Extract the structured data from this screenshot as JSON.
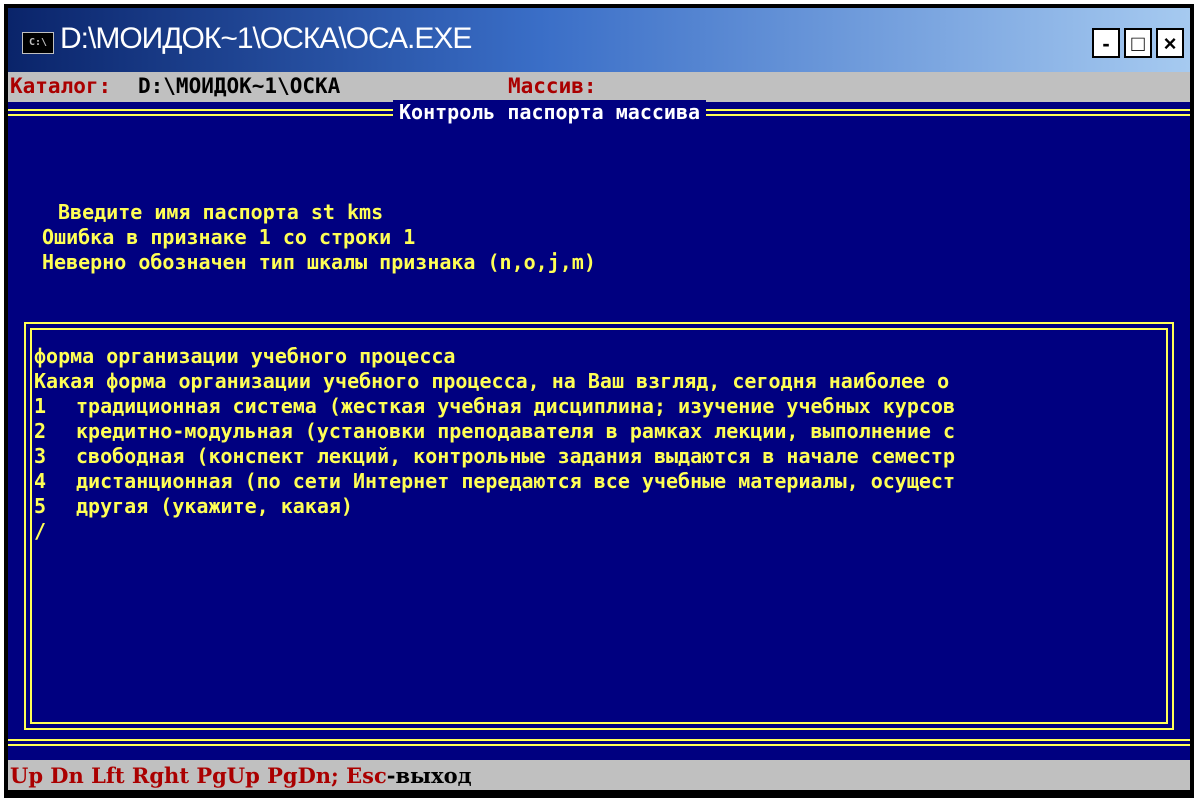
{
  "window": {
    "title": "D:\\МОИДОК~1\\ОСКА\\ОСА.EXE",
    "icon_text": "C:\\",
    "buttons": [
      "-",
      "□",
      "×"
    ]
  },
  "topbar": {
    "catalog_label": "Каталог:",
    "catalog_value": "D:\\МОИДОК~1\\ОСКА",
    "array_label": "Массив:"
  },
  "heading": "Контроль паспорта массива",
  "messages": [
    "Введите имя паспорта st kms",
    "Ошибка в признаке 1 со строки 1",
    "Неверно обозначен тип шкалы признака (n,o,j,m)"
  ],
  "content": {
    "title": "форма организации учебного процесса",
    "question": "Какая форма организации учебного процесса, на Ваш взгляд, сегодня наиболее о",
    "options": [
      {
        "num": "1",
        "text": "традиционная система (жесткая учебная дисциплина; изучение учебных курсов"
      },
      {
        "num": "2",
        "text": "кредитно-модульная (установки преподавателя в рамках лекции, выполнение с"
      },
      {
        "num": "3",
        "text": "свободная (конспект лекций, контрольные задания выдаются в начале семестр"
      },
      {
        "num": "4",
        "text": "дистанционная (по сети Интернет передаются все учебные материалы, осущест"
      },
      {
        "num": "5",
        "text": "другая (укажите, какая)"
      }
    ],
    "end_marker": "/"
  },
  "status": {
    "keys": "Up Dn Lft Rght PgUp PgDn; Esc",
    "action": "-выход"
  },
  "colors": {
    "background": "#000080",
    "text": "#ffff55",
    "heading": "#ffffff",
    "label_red": "#aa0000",
    "bar": "#c0c0c0"
  }
}
